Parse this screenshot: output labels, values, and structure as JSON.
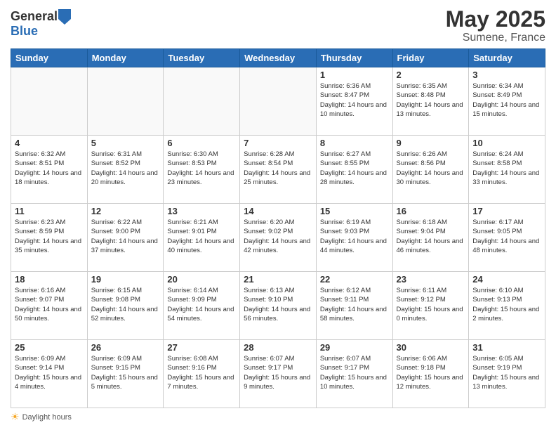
{
  "header": {
    "logo_general": "General",
    "logo_blue": "Blue",
    "main_title": "May 2025",
    "subtitle": "Sumene, France"
  },
  "calendar": {
    "days_of_week": [
      "Sunday",
      "Monday",
      "Tuesday",
      "Wednesday",
      "Thursday",
      "Friday",
      "Saturday"
    ],
    "weeks": [
      [
        {
          "day": "",
          "info": ""
        },
        {
          "day": "",
          "info": ""
        },
        {
          "day": "",
          "info": ""
        },
        {
          "day": "",
          "info": ""
        },
        {
          "day": "1",
          "info": "Sunrise: 6:36 AM\nSunset: 8:47 PM\nDaylight: 14 hours and 10 minutes."
        },
        {
          "day": "2",
          "info": "Sunrise: 6:35 AM\nSunset: 8:48 PM\nDaylight: 14 hours and 13 minutes."
        },
        {
          "day": "3",
          "info": "Sunrise: 6:34 AM\nSunset: 8:49 PM\nDaylight: 14 hours and 15 minutes."
        }
      ],
      [
        {
          "day": "4",
          "info": "Sunrise: 6:32 AM\nSunset: 8:51 PM\nDaylight: 14 hours and 18 minutes."
        },
        {
          "day": "5",
          "info": "Sunrise: 6:31 AM\nSunset: 8:52 PM\nDaylight: 14 hours and 20 minutes."
        },
        {
          "day": "6",
          "info": "Sunrise: 6:30 AM\nSunset: 8:53 PM\nDaylight: 14 hours and 23 minutes."
        },
        {
          "day": "7",
          "info": "Sunrise: 6:28 AM\nSunset: 8:54 PM\nDaylight: 14 hours and 25 minutes."
        },
        {
          "day": "8",
          "info": "Sunrise: 6:27 AM\nSunset: 8:55 PM\nDaylight: 14 hours and 28 minutes."
        },
        {
          "day": "9",
          "info": "Sunrise: 6:26 AM\nSunset: 8:56 PM\nDaylight: 14 hours and 30 minutes."
        },
        {
          "day": "10",
          "info": "Sunrise: 6:24 AM\nSunset: 8:58 PM\nDaylight: 14 hours and 33 minutes."
        }
      ],
      [
        {
          "day": "11",
          "info": "Sunrise: 6:23 AM\nSunset: 8:59 PM\nDaylight: 14 hours and 35 minutes."
        },
        {
          "day": "12",
          "info": "Sunrise: 6:22 AM\nSunset: 9:00 PM\nDaylight: 14 hours and 37 minutes."
        },
        {
          "day": "13",
          "info": "Sunrise: 6:21 AM\nSunset: 9:01 PM\nDaylight: 14 hours and 40 minutes."
        },
        {
          "day": "14",
          "info": "Sunrise: 6:20 AM\nSunset: 9:02 PM\nDaylight: 14 hours and 42 minutes."
        },
        {
          "day": "15",
          "info": "Sunrise: 6:19 AM\nSunset: 9:03 PM\nDaylight: 14 hours and 44 minutes."
        },
        {
          "day": "16",
          "info": "Sunrise: 6:18 AM\nSunset: 9:04 PM\nDaylight: 14 hours and 46 minutes."
        },
        {
          "day": "17",
          "info": "Sunrise: 6:17 AM\nSunset: 9:05 PM\nDaylight: 14 hours and 48 minutes."
        }
      ],
      [
        {
          "day": "18",
          "info": "Sunrise: 6:16 AM\nSunset: 9:07 PM\nDaylight: 14 hours and 50 minutes."
        },
        {
          "day": "19",
          "info": "Sunrise: 6:15 AM\nSunset: 9:08 PM\nDaylight: 14 hours and 52 minutes."
        },
        {
          "day": "20",
          "info": "Sunrise: 6:14 AM\nSunset: 9:09 PM\nDaylight: 14 hours and 54 minutes."
        },
        {
          "day": "21",
          "info": "Sunrise: 6:13 AM\nSunset: 9:10 PM\nDaylight: 14 hours and 56 minutes."
        },
        {
          "day": "22",
          "info": "Sunrise: 6:12 AM\nSunset: 9:11 PM\nDaylight: 14 hours and 58 minutes."
        },
        {
          "day": "23",
          "info": "Sunrise: 6:11 AM\nSunset: 9:12 PM\nDaylight: 15 hours and 0 minutes."
        },
        {
          "day": "24",
          "info": "Sunrise: 6:10 AM\nSunset: 9:13 PM\nDaylight: 15 hours and 2 minutes."
        }
      ],
      [
        {
          "day": "25",
          "info": "Sunrise: 6:09 AM\nSunset: 9:14 PM\nDaylight: 15 hours and 4 minutes."
        },
        {
          "day": "26",
          "info": "Sunrise: 6:09 AM\nSunset: 9:15 PM\nDaylight: 15 hours and 5 minutes."
        },
        {
          "day": "27",
          "info": "Sunrise: 6:08 AM\nSunset: 9:16 PM\nDaylight: 15 hours and 7 minutes."
        },
        {
          "day": "28",
          "info": "Sunrise: 6:07 AM\nSunset: 9:17 PM\nDaylight: 15 hours and 9 minutes."
        },
        {
          "day": "29",
          "info": "Sunrise: 6:07 AM\nSunset: 9:17 PM\nDaylight: 15 hours and 10 minutes."
        },
        {
          "day": "30",
          "info": "Sunrise: 6:06 AM\nSunset: 9:18 PM\nDaylight: 15 hours and 12 minutes."
        },
        {
          "day": "31",
          "info": "Sunrise: 6:05 AM\nSunset: 9:19 PM\nDaylight: 15 hours and 13 minutes."
        }
      ]
    ]
  },
  "footer": {
    "note": "Daylight hours"
  }
}
